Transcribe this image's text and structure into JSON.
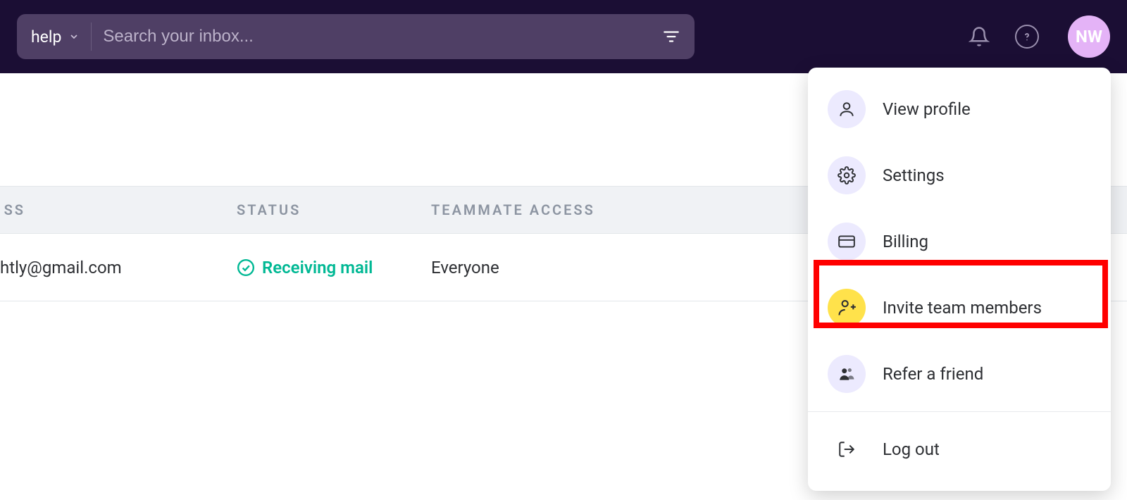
{
  "topbar": {
    "inbox_selector": "help",
    "search_placeholder": "Search your inbox...",
    "avatar_initials": "NW"
  },
  "table": {
    "headers": {
      "ss": "SS",
      "status": "STATUS",
      "teammate_access": "TEAMMATE ACCESS"
    },
    "rows": [
      {
        "address_fragment": "htly@gmail.com",
        "status": "Receiving mail",
        "teammate_access": "Everyone"
      }
    ]
  },
  "menu": {
    "items": [
      {
        "label": "View profile",
        "icon": "user"
      },
      {
        "label": "Settings",
        "icon": "gear"
      },
      {
        "label": "Billing",
        "icon": "card"
      },
      {
        "label": "Invite team members",
        "icon": "user-plus",
        "highlighted": true
      },
      {
        "label": "Refer a friend",
        "icon": "people"
      }
    ],
    "footer": {
      "label": "Log out",
      "icon": "logout"
    }
  }
}
